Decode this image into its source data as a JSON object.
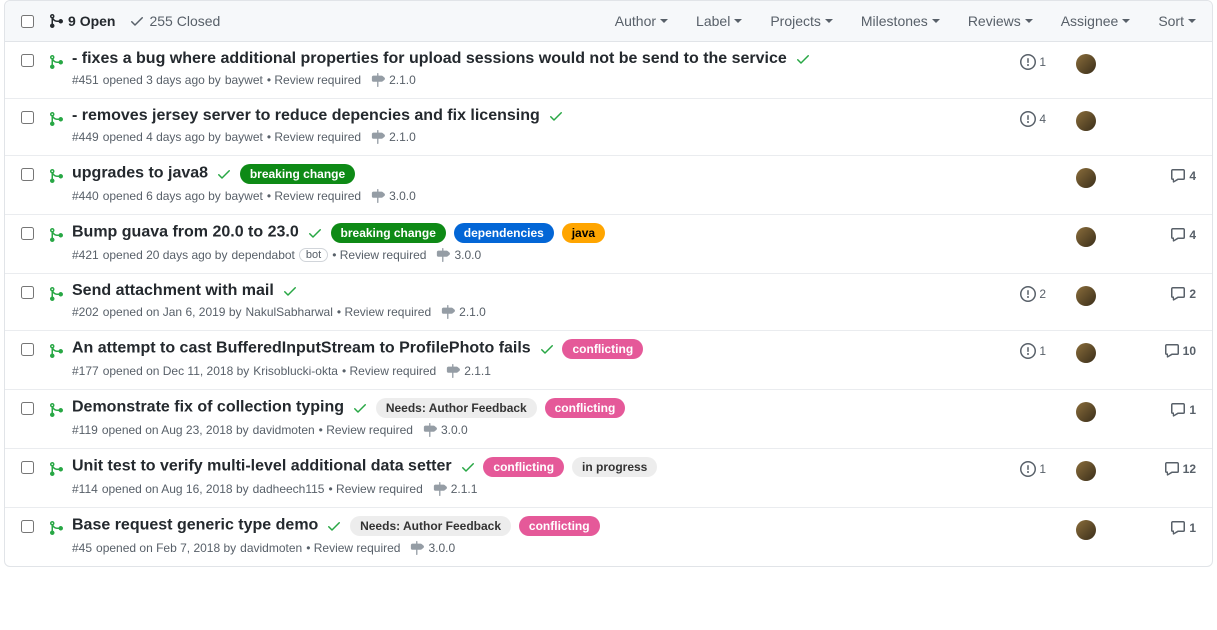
{
  "header": {
    "open": {
      "count": "9",
      "label": "Open"
    },
    "closed": {
      "count": "255",
      "label": "Closed"
    },
    "filters": [
      "Author",
      "Label",
      "Projects",
      "Milestones",
      "Reviews",
      "Assignee",
      "Sort"
    ]
  },
  "label_colors": {
    "breaking change": {
      "bg": "#0e8a16",
      "fg": "#ffffff"
    },
    "dependencies": {
      "bg": "#0366d6",
      "fg": "#ffffff"
    },
    "java": {
      "bg": "#ffa500",
      "fg": "#000000"
    },
    "conflicting": {
      "bg": "#e55999",
      "fg": "#ffffff"
    },
    "Needs: Author Feedback": {
      "bg": "#ededed",
      "fg": "#333333"
    },
    "in progress": {
      "bg": "#ededed",
      "fg": "#333333"
    }
  },
  "items": [
    {
      "title": "- fixes a bug where additional properties for upload sessions would not be send to the service",
      "number": "#451",
      "opened": "opened 3 days ago by",
      "author": "baywet",
      "review": "Review required",
      "milestone": "2.1.0",
      "labels": [],
      "alert": "1",
      "avatar": true,
      "comments": ""
    },
    {
      "title": "- removes jersey server to reduce depencies and fix licensing",
      "number": "#449",
      "opened": "opened 4 days ago by",
      "author": "baywet",
      "review": "Review required",
      "milestone": "2.1.0",
      "labels": [],
      "alert": "4",
      "avatar": true,
      "comments": ""
    },
    {
      "title": "upgrades to java8",
      "number": "#440",
      "opened": "opened 6 days ago by",
      "author": "baywet",
      "review": "Review required",
      "milestone": "3.0.0",
      "labels": [
        "breaking change"
      ],
      "alert": "",
      "avatar": true,
      "comments": "4"
    },
    {
      "title": "Bump guava from 20.0 to 23.0",
      "number": "#421",
      "opened": "opened 20 days ago by",
      "author": "dependabot",
      "bot": "bot",
      "review": "Review required",
      "milestone": "3.0.0",
      "labels": [
        "breaking change",
        "dependencies",
        "java"
      ],
      "alert": "",
      "avatar": true,
      "comments": "4"
    },
    {
      "title": "Send attachment with mail",
      "number": "#202",
      "opened": "opened on Jan 6, 2019 by",
      "author": "NakulSabharwal",
      "review": "Review required",
      "milestone": "2.1.0",
      "labels": [],
      "alert": "2",
      "avatar": true,
      "comments": "2"
    },
    {
      "title": "An attempt to cast BufferedInputStream to ProfilePhoto fails",
      "number": "#177",
      "opened": "opened on Dec 11, 2018 by",
      "author": "Krisoblucki-okta",
      "review": "Review required",
      "milestone": "2.1.1",
      "labels": [
        "conflicting"
      ],
      "alert": "1",
      "avatar": true,
      "comments": "10"
    },
    {
      "title": "Demonstrate fix of collection typing",
      "number": "#119",
      "opened": "opened on Aug 23, 2018 by",
      "author": "davidmoten",
      "review": "Review required",
      "milestone": "3.0.0",
      "labels": [
        "Needs: Author Feedback",
        "conflicting"
      ],
      "alert": "",
      "avatar": true,
      "comments": "1"
    },
    {
      "title": "Unit test to verify multi-level additional data setter",
      "number": "#114",
      "opened": "opened on Aug 16, 2018 by",
      "author": "dadheech115",
      "review": "Review required",
      "milestone": "2.1.1",
      "labels": [
        "conflicting",
        "in progress"
      ],
      "alert": "1",
      "avatar": true,
      "comments": "12"
    },
    {
      "title": "Base request generic type demo",
      "number": "#45",
      "opened": "opened on Feb 7, 2018 by",
      "author": "davidmoten",
      "review": "Review required",
      "milestone": "3.0.0",
      "labels": [
        "Needs: Author Feedback",
        "conflicting"
      ],
      "alert": "",
      "avatar": true,
      "comments": "1"
    }
  ]
}
